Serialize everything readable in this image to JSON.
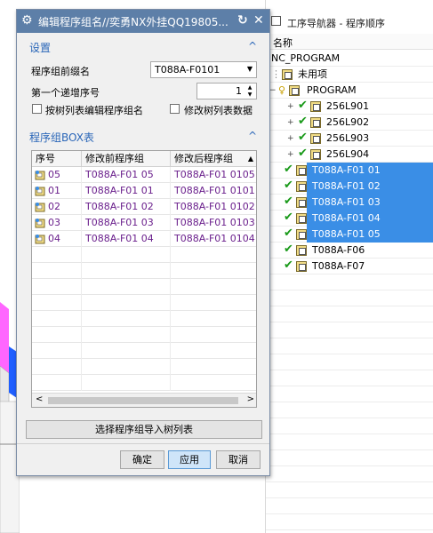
{
  "dialog": {
    "title": "编辑程序组名//奕勇NX外挂QQ19805...",
    "settings": {
      "header": "设置",
      "prefix_label": "程序组前缀名",
      "prefix_value": "T088A-F0101",
      "start_label": "第一个递增序号",
      "start_value": "1",
      "cb_tree_label": "按树列表编辑程序组名",
      "cb_modify_label": "修改树列表数据"
    },
    "box": {
      "header": "程序组BOX表",
      "columns": [
        "序号",
        "修改前程序组",
        "修改后程序组"
      ],
      "rows": [
        {
          "seq": "05",
          "before": "T088A-F01 05",
          "after": "T088A-F01 0105"
        },
        {
          "seq": "01",
          "before": "T088A-F01 01",
          "after": "T088A-F01 0101"
        },
        {
          "seq": "02",
          "before": "T088A-F01 02",
          "after": "T088A-F01 0102"
        },
        {
          "seq": "03",
          "before": "T088A-F01 03",
          "after": "T088A-F01 0103"
        },
        {
          "seq": "04",
          "before": "T088A-F01 04",
          "after": "T088A-F01 0104"
        }
      ],
      "import_label": "选择程序组导入树列表"
    },
    "buttons": {
      "ok": "确定",
      "apply": "应用",
      "cancel": "取消"
    }
  },
  "navigator": {
    "title": "工序导航器 - 程序顺序",
    "column": "名称",
    "items": [
      {
        "label": "NC_PROGRAM"
      },
      {
        "label": "未用项"
      },
      {
        "label": "PROGRAM"
      },
      {
        "label": "256L901"
      },
      {
        "label": "256L902"
      },
      {
        "label": "256L903"
      },
      {
        "label": "256L904"
      },
      {
        "label": "T088A-F01 01"
      },
      {
        "label": "T088A-F01 02"
      },
      {
        "label": "T088A-F01 03"
      },
      {
        "label": "T088A-F01 04"
      },
      {
        "label": "T088A-F01 05"
      },
      {
        "label": "T088A-F06"
      },
      {
        "label": "T088A-F07"
      }
    ]
  },
  "colors": {
    "title_bar": "#5d7fa8",
    "section_header": "#2a66b8",
    "selection": "#3a8ee6",
    "row_text": "#6a1f8c",
    "check": "#1a9a1a"
  }
}
